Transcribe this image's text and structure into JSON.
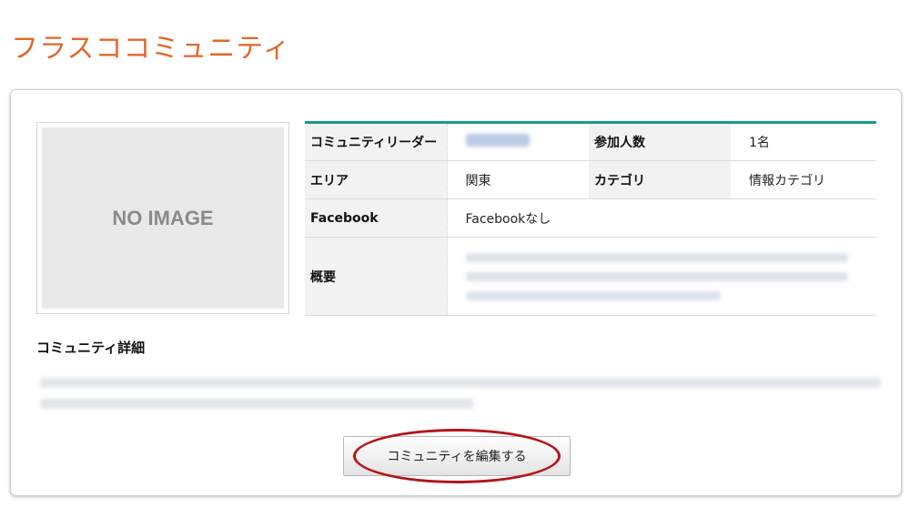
{
  "page": {
    "title": "フラスココミュニティ"
  },
  "image": {
    "placeholder_text": "NO IMAGE"
  },
  "info": {
    "leader_label": "コミュニティリーダー",
    "member_count_label": "参加人数",
    "member_count_value": "1名",
    "area_label": "エリア",
    "area_value": "関東",
    "category_label": "カテゴリ",
    "category_value": "情報カテゴリ",
    "facebook_label": "Facebook",
    "facebook_value": "Facebookなし",
    "overview_label": "概要"
  },
  "details": {
    "title": "コミュニティ詳細"
  },
  "actions": {
    "edit_label": "コミュニティを編集する"
  },
  "colors": {
    "title": "#e0692a",
    "table_accent": "#1a9a8e",
    "highlight": "#b3141b"
  }
}
